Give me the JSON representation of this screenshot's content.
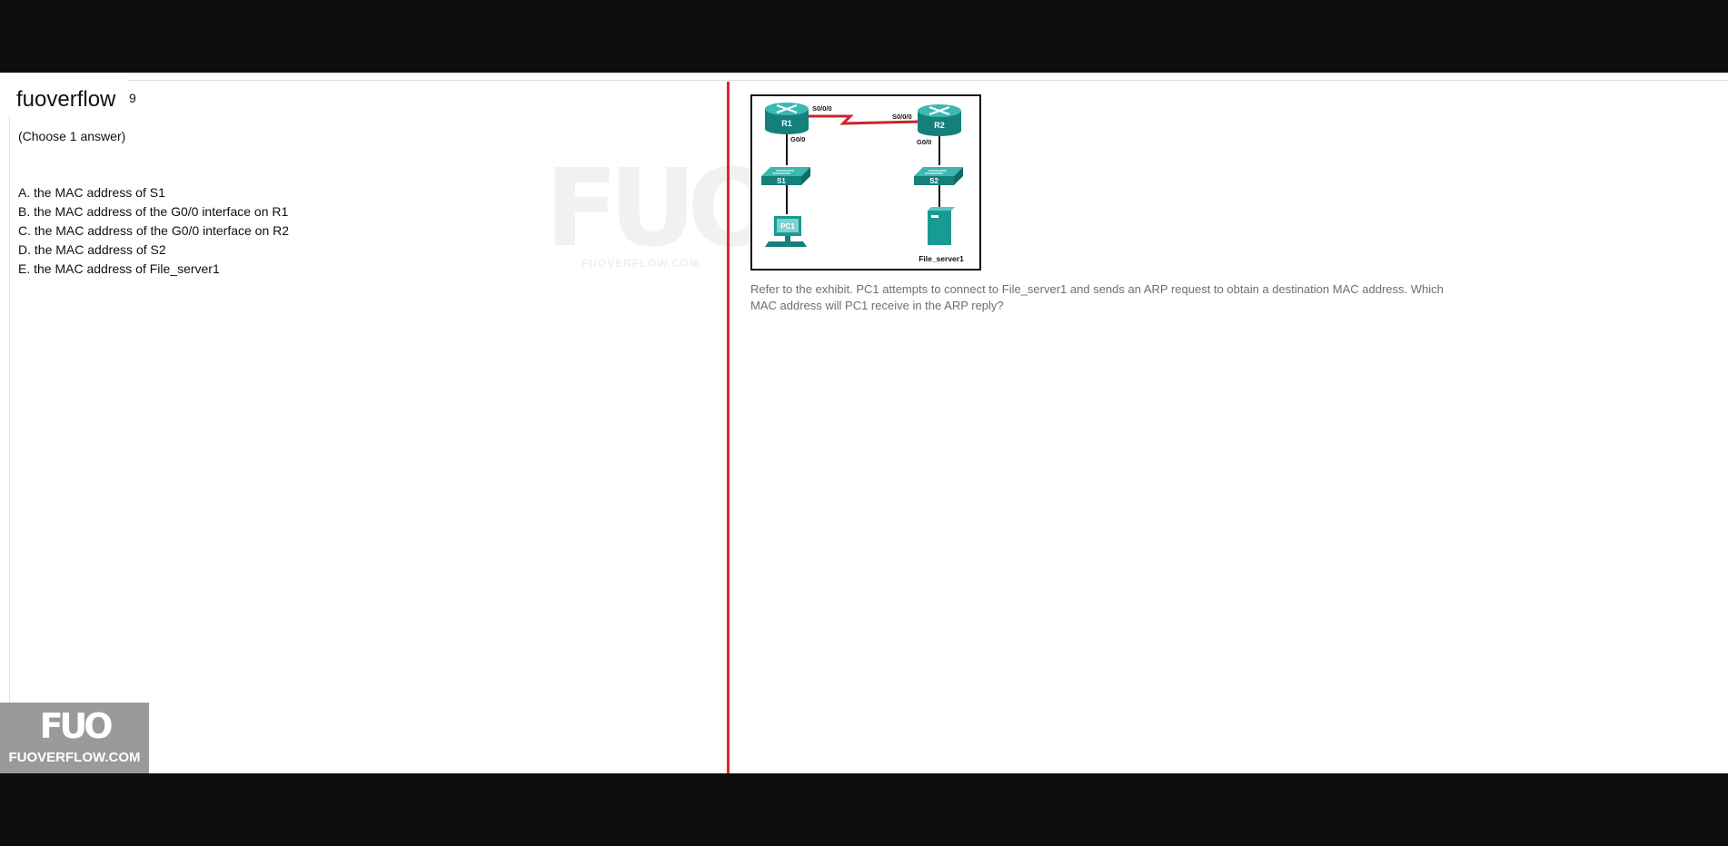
{
  "header": {
    "brand": "fuoverflow",
    "question_number": "9"
  },
  "question": {
    "instruction": "(Choose 1 answer)",
    "options": [
      "A. the MAC address of S1",
      "B. the MAC address of the G0/0 interface on R1",
      "C. the MAC address of the G0/0 interface on R2",
      "D. the MAC address of S2",
      "E. the MAC address of File_server1"
    ],
    "prompt": "Refer to the exhibit. PC1 attempts to connect to File_server1 and sends an ARP request to obtain a destination MAC address. Which MAC address will PC1 receive in the ARP reply?"
  },
  "watermark": {
    "mark": "FUO",
    "url": "FUOVERFLOW.COM"
  },
  "logo": {
    "mark": "FUO",
    "text": "FUOVERFLOW.COM"
  },
  "exhibit": {
    "r1": "R1",
    "r2": "R2",
    "s1": "S1",
    "s2": "S2",
    "pc1": "PC1",
    "r1_serial": "S0/0/0",
    "r2_serial": "S0/0/0",
    "r1_g": "G0/0",
    "r2_g": "G0/0",
    "server": "File_server1"
  },
  "colors": {
    "divider": "#e3262c",
    "device": "#1a9a94",
    "serial_link": "#d0212b"
  }
}
